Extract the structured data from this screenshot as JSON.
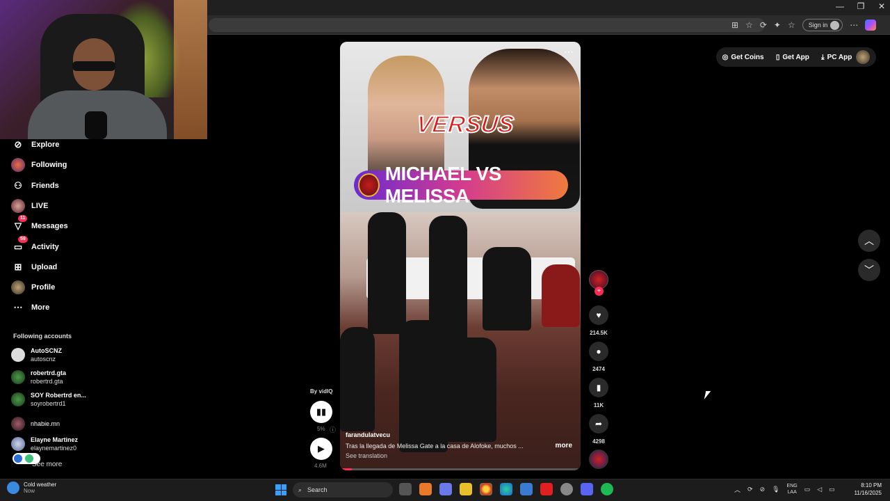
{
  "browser": {
    "signin_label": "Sign in",
    "window_controls": [
      "—",
      "❐",
      "✕"
    ]
  },
  "sidebar": {
    "items": [
      {
        "label": "Explore",
        "icon": "compass-icon"
      },
      {
        "label": "Following",
        "icon": "avatar"
      },
      {
        "label": "Friends",
        "icon": "friends-icon"
      },
      {
        "label": "LIVE",
        "icon": "avatar"
      },
      {
        "label": "Messages",
        "icon": "messages-icon",
        "badge": "11"
      },
      {
        "label": "Activity",
        "icon": "activity-icon",
        "badge": "59"
      },
      {
        "label": "Upload",
        "icon": "upload-icon"
      },
      {
        "label": "Profile",
        "icon": "avatar"
      },
      {
        "label": "More",
        "icon": "more-icon"
      }
    ],
    "following_title": "Following accounts",
    "accounts": [
      {
        "name": "AutoSCNZ",
        "handle": "autoscnz"
      },
      {
        "name": "robertrd.gta",
        "handle": "robertrd.gta"
      },
      {
        "name": "SOY Robertrd en...",
        "handle": "soyrobertrd1"
      },
      {
        "name": "nhabie.mn",
        "handle": ""
      },
      {
        "name": "Elayne Martinez",
        "handle": "elaynemartinez0"
      }
    ],
    "see_more": "See more"
  },
  "topbar": {
    "get_coins": "Get Coins",
    "get_app": "Get App",
    "pc_app": "PC App"
  },
  "video": {
    "overlay_word": "VERSUS",
    "banner_title": "MICHAEL VS MELISSA",
    "username": "farandulatvecu",
    "description": "Tras la llegada de Melissa Gate a la casa de Alofoke, muchos ...",
    "see_translation": "See translation",
    "more_label": "more",
    "progress_fraction": 0.05
  },
  "side_controls": {
    "by_label": "By vidIQ",
    "percent": "5%",
    "views": "4.6M"
  },
  "actions": {
    "likes": "214.5K",
    "comments": "2474",
    "saves": "11K",
    "shares": "4298"
  },
  "taskbar": {
    "weather_title": "Cold weather",
    "weather_sub": "Now",
    "search_placeholder": "Search",
    "lang_line1": "ENG",
    "lang_line2": "LAA",
    "time": "8:10 PM",
    "date": "11/16/2025"
  }
}
